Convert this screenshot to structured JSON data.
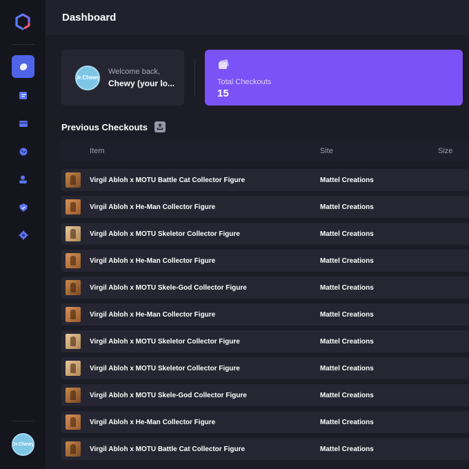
{
  "header": {
    "title": "Dashboard"
  },
  "sidebar": {
    "avatar_text": "Dr.Chewy",
    "items": [
      {
        "name": "dashboard",
        "icon": "dashboard-icon",
        "active": true
      },
      {
        "name": "tasks",
        "icon": "tasks-icon",
        "active": false
      },
      {
        "name": "profiles",
        "icon": "card-icon",
        "active": false
      },
      {
        "name": "proxies",
        "icon": "globe-icon",
        "active": false
      },
      {
        "name": "accounts",
        "icon": "users-icon",
        "active": false
      },
      {
        "name": "checkouts",
        "icon": "shield-check-icon",
        "active": false
      },
      {
        "name": "settings",
        "icon": "gear-icon",
        "active": false
      }
    ]
  },
  "welcome": {
    "label": "Welcome back,",
    "name": "Chewy (your lo...",
    "avatar_text": "Dr.Chewy"
  },
  "stats": {
    "total_checkouts_label": "Total Checkouts",
    "total_checkouts_value": "15"
  },
  "previous_checkouts": {
    "title": "Previous Checkouts",
    "columns": {
      "item": "Item",
      "site": "Site",
      "size": "Size"
    },
    "rows": [
      {
        "item": "Virgil Abloh x MOTU Battle Cat Collector Figure",
        "site": "Mattel Creations"
      },
      {
        "item": "Virgil Abloh x He-Man Collector Figure",
        "site": "Mattel Creations"
      },
      {
        "item": "Virgil Abloh x MOTU Skeletor Collector Figure",
        "site": "Mattel Creations"
      },
      {
        "item": "Virgil Abloh x He-Man Collector Figure",
        "site": "Mattel Creations"
      },
      {
        "item": "Virgil Abloh x MOTU Skele-God Collector Figure",
        "site": "Mattel Creations"
      },
      {
        "item": "Virgil Abloh x He-Man Collector Figure",
        "site": "Mattel Creations"
      },
      {
        "item": "Virgil Abloh x MOTU Skeletor Collector Figure",
        "site": "Mattel Creations"
      },
      {
        "item": "Virgil Abloh x MOTU Skeletor Collector Figure",
        "site": "Mattel Creations"
      },
      {
        "item": "Virgil Abloh x MOTU Skele-God Collector Figure",
        "site": "Mattel Creations"
      },
      {
        "item": "Virgil Abloh x He-Man Collector Figure",
        "site": "Mattel Creations"
      },
      {
        "item": "Virgil Abloh x MOTU Battle Cat Collector Figure",
        "site": "Mattel Creations"
      }
    ]
  },
  "colors": {
    "accent": "#4f63e8",
    "stat_card": "#7b52f5",
    "background": "#1c1c27"
  }
}
